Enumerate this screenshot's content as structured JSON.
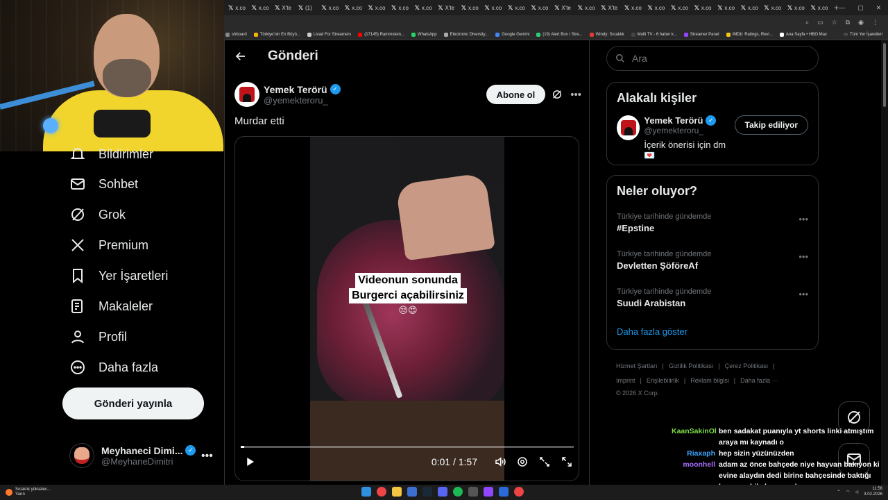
{
  "browser": {
    "tabs": [
      "x.co",
      "x.co",
      "X'te",
      "(1)",
      "x.co",
      "x.co",
      "x.co",
      "x.co",
      "x.co",
      "X'te",
      "x.co",
      "x.co",
      "x.co",
      "x.co",
      "X'te",
      "x.co",
      "X'te",
      "x.co",
      "x.co",
      "x.co",
      "x.co",
      "x.co",
      "x.co",
      "x.co",
      "x.co",
      "x.co"
    ],
    "bookmarks": [
      {
        "label": "shboard",
        "color": "#888"
      },
      {
        "label": "Türkiye'nin En Büyü...",
        "color": "#f4b400"
      },
      {
        "label": "Livad For Streamers",
        "color": "#ccc"
      },
      {
        "label": "(17145) Rammstein...",
        "color": "#ff0000"
      },
      {
        "label": "WhatsApp",
        "color": "#25d366"
      },
      {
        "label": "Electronic Diversity...",
        "color": "#aaa"
      },
      {
        "label": "Google Gemini",
        "color": "#4285f4"
      },
      {
        "label": "(19) Alert Box / Stre...",
        "color": "#2ecc71"
      },
      {
        "label": "Windy: Sıcaklık",
        "color": "#e53935"
      },
      {
        "label": "Multi TV - 6 haber k...",
        "color": "#444"
      },
      {
        "label": "Streamer Panel",
        "color": "#9146ff"
      },
      {
        "label": "IMDb: Ratings, Revi...",
        "color": "#f5c518"
      },
      {
        "label": "Ana Sayfa • HBO Max",
        "color": "#fff"
      }
    ],
    "all_bookmarks": "Tüm Yer İşaretleri"
  },
  "nav": {
    "items": [
      {
        "label": "Bildirimler",
        "icon": "bell-icon"
      },
      {
        "label": "Sohbet",
        "icon": "mail-icon"
      },
      {
        "label": "Grok",
        "icon": "grok-icon"
      },
      {
        "label": "Premium",
        "icon": "x-logo-icon"
      },
      {
        "label": "Yer İşaretleri",
        "icon": "bookmark-icon"
      },
      {
        "label": "Makaleler",
        "icon": "article-icon"
      },
      {
        "label": "Profil",
        "icon": "person-icon"
      },
      {
        "label": "Daha fazla",
        "icon": "more-circle-icon"
      }
    ],
    "post_button": "Gönderi yayınla",
    "account": {
      "name": "Meyhaneci Dimi...",
      "handle": "@MeyhaneDimitri"
    }
  },
  "post": {
    "header_title": "Gönderi",
    "author_name": "Yemek Terörü",
    "author_handle": "@yemekteroru_",
    "subscribe_label": "Abone ol",
    "text": "Murdar etti",
    "video": {
      "caption_line1": "Videonun sonunda",
      "caption_line2": "Burgerci açabilirsiniz",
      "caption_emoji": "😒😍",
      "current_time": "0:01",
      "duration": "1:57",
      "time_display": "0:01 / 1:57",
      "progress": 0.01
    }
  },
  "sidebar": {
    "search_placeholder": "Ara",
    "related": {
      "title": "Alakalı kişiler",
      "name": "Yemek Terörü",
      "handle": "@yemekteroru_",
      "bio": "İçerik önerisi için dm💌",
      "follow_label": "Takip ediliyor"
    },
    "trends": {
      "title": "Neler oluyor?",
      "items": [
        {
          "context": "Türkiye tarihinde gündemde",
          "topic": "#Epstine"
        },
        {
          "context": "Türkiye tarihinde gündemde",
          "topic": "Devletten ŞöföreAf"
        },
        {
          "context": "Türkiye tarihinde gündemde",
          "topic": "Suudi Arabistan"
        }
      ],
      "show_more": "Daha fazla göster"
    },
    "footer": {
      "row1": [
        "Hizmet Şartları",
        "|",
        "Gizlilik Politikası",
        "|",
        "Çerez Politikası",
        "|"
      ],
      "row2": [
        "Imprint",
        "|",
        "Erişilebilirlik",
        "|",
        "Reklam bilgisi",
        "|",
        "Daha fazla ···"
      ],
      "copyright": "© 2026 X Corp."
    }
  },
  "chat": [
    {
      "user": "KaanSakinOl",
      "color": "#7ddc4a",
      "text": "ben sadakat puanıyla yt shorts linki atmıştım"
    },
    {
      "user": "",
      "color": "#7ddc4a",
      "text": "araya mı kaynadı o"
    },
    {
      "user": "Riaxaph",
      "color": "#3ea6ff",
      "text": "hep sizin yüzünüzden"
    },
    {
      "user": "moonhell",
      "color": "#a970ff",
      "text": "adam az önce bahçede niye hayvan bakıyon ki"
    },
    {
      "user": "",
      "color": "#a970ff",
      "text": "evine alaydın dedi birine bahçesinde baktığı"
    },
    {
      "user": "",
      "color": "#a970ff",
      "text": "hayvana bile huzur yok aw"
    }
  ],
  "taskbar": {
    "weather_line1": "Sıcaklık yükselec...",
    "weather_line2": "Yarın",
    "time": "11:56",
    "date": "3.02.2026"
  }
}
